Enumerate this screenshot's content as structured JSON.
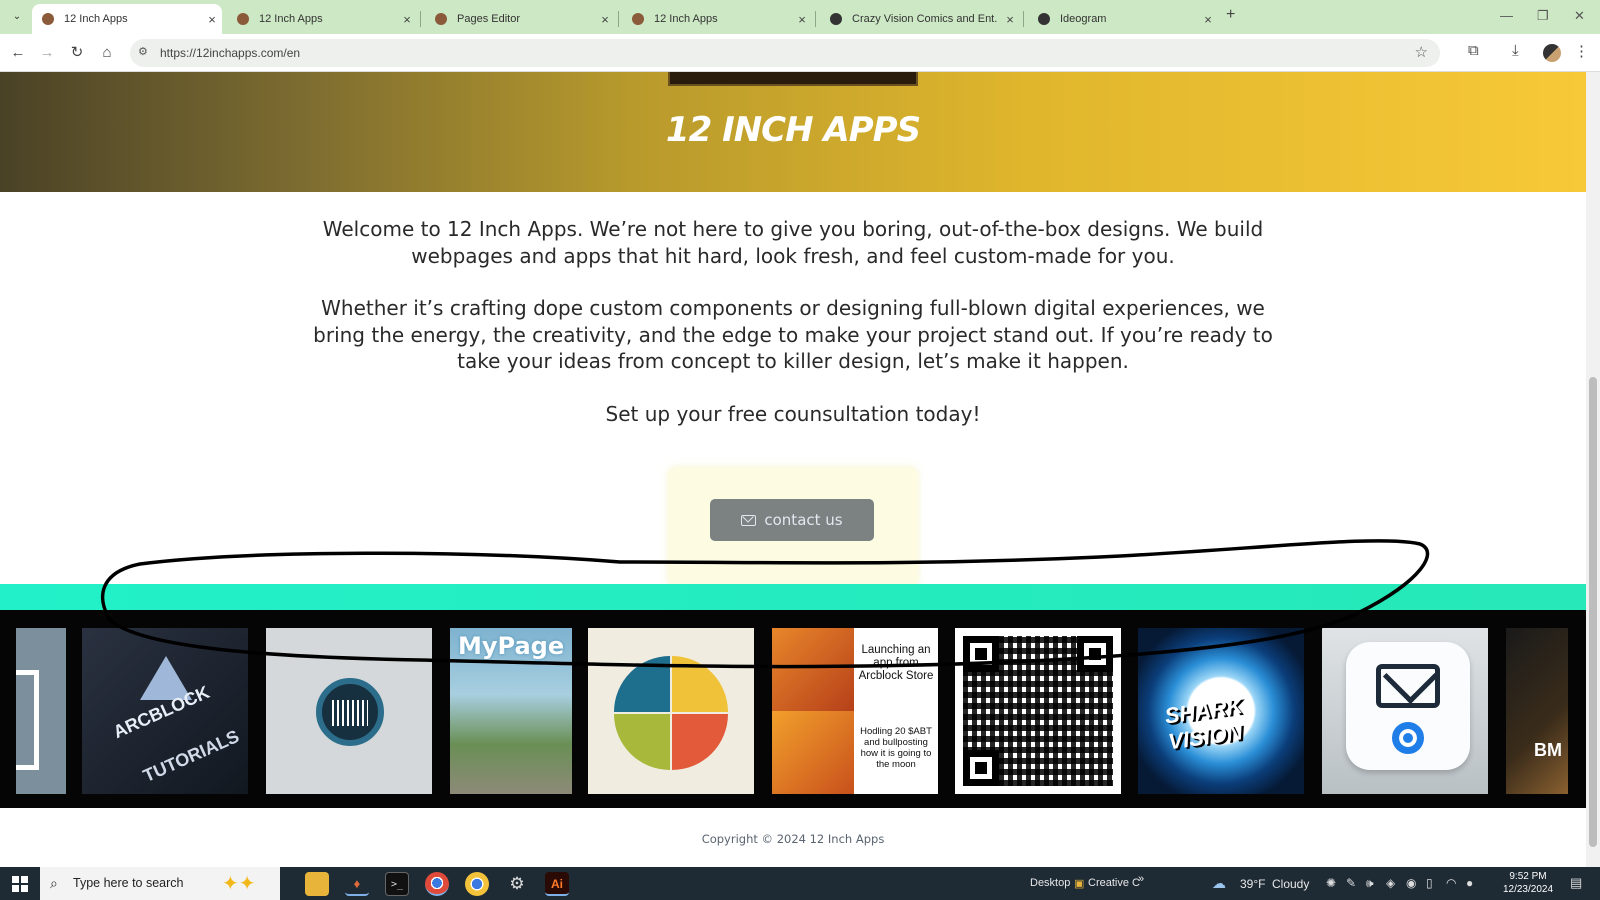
{
  "browser": {
    "tabs": [
      {
        "title": "12 Inch Apps",
        "active": true
      },
      {
        "title": "12 Inch Apps",
        "active": false
      },
      {
        "title": "Pages Editor",
        "active": false
      },
      {
        "title": "12 Inch Apps",
        "active": false
      },
      {
        "title": "Crazy Vision Comics and Ent.",
        "active": false
      },
      {
        "title": "Ideogram",
        "active": false
      }
    ],
    "url": "https://12inchapps.com/en",
    "new_tab": "+",
    "close_glyph": "×"
  },
  "hero": {
    "title": "12 INCH APPS",
    "gradient": [
      "#4a4226",
      "#b89a2c",
      "#f7c938"
    ]
  },
  "content": {
    "intro": "Welcome to 12 Inch Apps. We’re not here to give you boring, out-of-the-box designs. We build webpages and apps that hit hard, look fresh, and feel custom-made for you.",
    "body": "Whether it’s crafting dope custom components or designing full-blown digital experiences, we bring the energy, the creativity, and the edge to make your project stand out. If you’re ready to take your ideas from concept to killer design, let’s make it happen.",
    "cta": "Set up your free counsultation today!",
    "contact_button": "contact us"
  },
  "gallery": {
    "arcblock_title": "ARCBLOCK",
    "arcblock_sub": "TUTORIALS",
    "mypage": "MyPage",
    "meme_top": "Launching an app from Arcblock Store",
    "meme_bottom": "Hodling 20 $ABT and bullposting how it is going to the moon",
    "eye_tag": "SHARK VISION",
    "frag_text": "BM"
  },
  "footer": {
    "copyright": "Copyright © 2024 12 Inch Apps"
  },
  "taskbar": {
    "search_placeholder": "Type here to search",
    "desktop_label": "Desktop",
    "creative_label": "Creative C",
    "weather_temp": "39°F",
    "weather_desc": "Cloudy",
    "time": "9:52 PM",
    "date": "12/23/2024"
  },
  "colors": {
    "accent_band": "#22f0c8",
    "taskbar": "#1e2a34",
    "tabstrip": "#cde8c4",
    "button": "#7c8182"
  },
  "icons": [
    "tab-search-icon",
    "back-icon",
    "forward-icon",
    "reload-icon",
    "home-icon",
    "site-info-icon",
    "bookmark-star-icon",
    "extensions-icon",
    "downloads-icon",
    "profile-avatar",
    "menu-kebab-icon",
    "mail-icon",
    "windows-start-icon",
    "search-icon",
    "file-explorer-icon",
    "terminal-icon",
    "chrome-icon",
    "settings-icon",
    "illustrator-icon",
    "cloud-icon"
  ]
}
